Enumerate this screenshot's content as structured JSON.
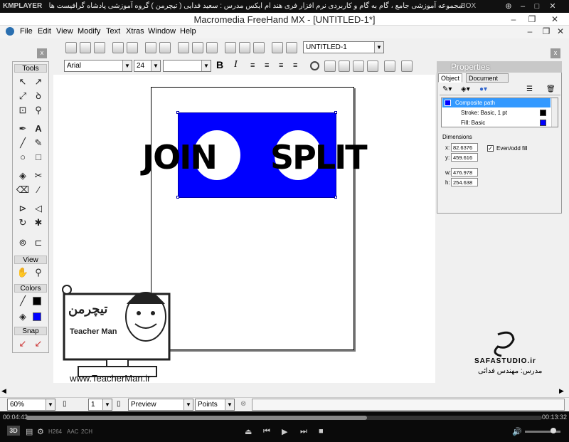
{
  "player": {
    "logo": "KMPLAYER",
    "title": "مجموعه آموزشی جامع ، گام به گام و کاربردی نرم افزار فری هند ام ایکس  مدرس : سعید فدایی ( تیچرمن ) گروه آموزشی پادشاه گرافیست ها",
    "box_label": "BOX",
    "time_elapsed": "00:04:43",
    "time_total": "00:13:32",
    "mode_3d": "3D",
    "badges": [
      "H264",
      "AAC",
      "2CH"
    ]
  },
  "app": {
    "title": "Macromedia FreeHand MX - [UNTITLED-1*]",
    "menu": [
      "File",
      "Edit",
      "View",
      "Modify",
      "Text",
      "Xtras",
      "Window",
      "Help"
    ],
    "document_select": "UNTITLED-1",
    "font_name": "Arial",
    "font_size": "24",
    "bold_label": "B",
    "italic_label": "I"
  },
  "tools_panel": {
    "title": "Tools",
    "view_label": "View",
    "colors_label": "Colors",
    "snap_label": "Snap",
    "close": "x"
  },
  "canvas": {
    "word_left": "JOIN",
    "word_right": "SPLIT"
  },
  "properties": {
    "title": "Properties",
    "tabs": [
      "Object",
      "Document"
    ],
    "items": [
      {
        "label": "Composite path"
      },
      {
        "label": "Stroke: Basic, 1 pt"
      },
      {
        "label": "Fill: Basic"
      }
    ],
    "dimensions_label": "Dimensions",
    "x_label": "x:",
    "x_value": "82.6376",
    "y_label": "y:",
    "y_value": "459.616",
    "w_label": "w:",
    "w_value": "476.978",
    "h_label": "h:",
    "h_value": "254.638",
    "even_odd_label": "Even/odd fill"
  },
  "statusbar": {
    "zoom": "60%",
    "page": "1",
    "mode": "Preview",
    "units": "Points"
  },
  "watermarks": {
    "teacher_logo_title": "تیچرمن",
    "teacher_logo_subtitle": "Teacher Man",
    "teacher_url": "www.TeacherMan.ir",
    "safa_name": "SAFASTUDIO.ir",
    "safa_teacher": "مدرس: مهندس فدائی"
  },
  "colors": {
    "blue": "#0000ff",
    "selection": "#3399ff"
  }
}
